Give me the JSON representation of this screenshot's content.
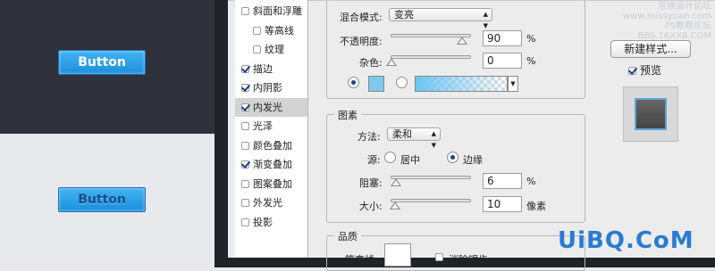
{
  "preview": {
    "dark_button_label": "Button",
    "light_button_label": "Button"
  },
  "style_list": [
    {
      "label": "斜面和浮雕",
      "checked": false,
      "sub": false,
      "active": false
    },
    {
      "label": "等高线",
      "checked": false,
      "sub": true,
      "active": false
    },
    {
      "label": "纹理",
      "checked": false,
      "sub": true,
      "active": false
    },
    {
      "label": "描边",
      "checked": true,
      "sub": false,
      "active": false
    },
    {
      "label": "内阴影",
      "checked": true,
      "sub": false,
      "active": false
    },
    {
      "label": "内发光",
      "checked": true,
      "sub": false,
      "active": true
    },
    {
      "label": "光泽",
      "checked": false,
      "sub": false,
      "active": false
    },
    {
      "label": "颜色叠加",
      "checked": false,
      "sub": false,
      "active": false
    },
    {
      "label": "渐变叠加",
      "checked": true,
      "sub": false,
      "active": false
    },
    {
      "label": "图案叠加",
      "checked": false,
      "sub": false,
      "active": false
    },
    {
      "label": "外发光",
      "checked": false,
      "sub": false,
      "active": false
    },
    {
      "label": "投影",
      "checked": false,
      "sub": false,
      "active": false
    }
  ],
  "blend": {
    "mode_label": "混合模式:",
    "mode_value": "变亮",
    "opacity_label": "不透明度:",
    "opacity_value": "90",
    "opacity_unit": "%",
    "opacity_fraction": 0.9,
    "noise_label": "杂色:",
    "noise_value": "0",
    "noise_unit": "%",
    "noise_fraction": 0.0,
    "glow_color": "#7fc8ec",
    "gradient_color": "#6cc4f2"
  },
  "elements": {
    "legend": "图素",
    "method_label": "方法:",
    "method_value": "柔和",
    "source_label": "源:",
    "source_center": "居中",
    "source_edge": "边缘",
    "choke_label": "阻塞:",
    "choke_value": "6",
    "choke_unit": "%",
    "choke_fraction": 0.06,
    "size_label": "大小:",
    "size_value": "10",
    "size_unit": "像素",
    "size_fraction": 0.04
  },
  "quality": {
    "legend": "品质",
    "contour_label": "等高线:",
    "antialias_label": "消除锯齿"
  },
  "right": {
    "new_style_label": "新建样式...",
    "preview_label": "预览"
  },
  "watermarks": {
    "top_line1": "思缘设计论坛",
    "top_line2": "www.missyuan.com",
    "top_line3": "PS教程论坛",
    "top_line4": "BBS.16XX8.COM",
    "bottom": "UiBQ.CoM"
  }
}
